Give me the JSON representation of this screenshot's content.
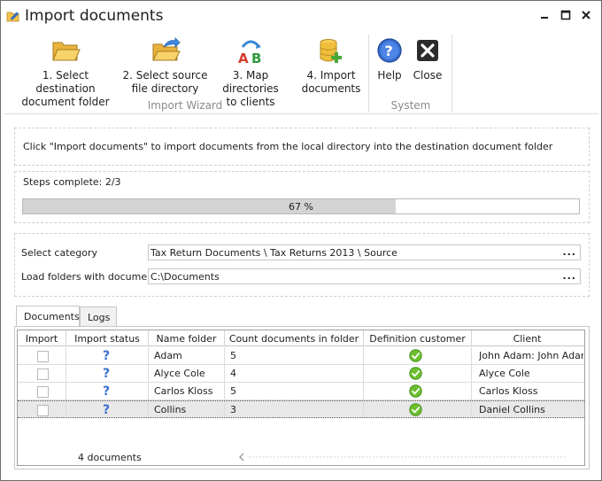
{
  "window": {
    "title": "Import documents"
  },
  "ribbon": {
    "items": [
      {
        "label": "1. Select destination\ndocument folder",
        "icon": "open-folder-icon"
      },
      {
        "label": "2. Select source\nfile directory",
        "icon": "folder-arrow-icon"
      },
      {
        "label": "3. Map directories\nto clients",
        "icon": "ab-map-icon"
      },
      {
        "label": "4. Import\ndocuments",
        "icon": "database-add-icon"
      },
      {
        "label": "Help",
        "icon": "help-icon"
      },
      {
        "label": "Close",
        "icon": "close-x-icon"
      }
    ],
    "groups": {
      "wizard": "Import Wizard",
      "system": "System"
    }
  },
  "instructions": "Click \"Import documents\" to import documents from the local directory into the destination document folder",
  "progress": {
    "label": "Steps complete: 2/3",
    "percent_text": "67 %",
    "fraction": 0.67
  },
  "fields": {
    "category_label": "Select category",
    "category_value": "Tax Return Documents \\ Tax Returns 2013 \\ Source",
    "folder_label": "Load folders with documents",
    "folder_value": "C:\\Documents",
    "browse": "..."
  },
  "tabs": [
    "Documents",
    "Logs"
  ],
  "grid": {
    "columns": [
      "Import",
      "Import status",
      "Name folder",
      "Count documents in folder",
      "Definition customer",
      "Client"
    ],
    "rows": [
      {
        "name": "Adam",
        "count": "5",
        "client": "John Adam: John Adam",
        "checked": false
      },
      {
        "name": "Alyce Cole",
        "count": "4",
        "client": "Alyce Cole",
        "checked": false
      },
      {
        "name": "Carlos Kloss",
        "count": "5",
        "client": "Carlos Kloss",
        "checked": false
      },
      {
        "name": "Collins",
        "count": "3",
        "client": "Daniel Collins",
        "checked": false,
        "selected": true
      }
    ],
    "footer": "4 documents"
  },
  "colors": {
    "accent_green": "#6bbf2d",
    "help_blue": "#2f63c9",
    "folder_yellow": "#f3c54a"
  }
}
